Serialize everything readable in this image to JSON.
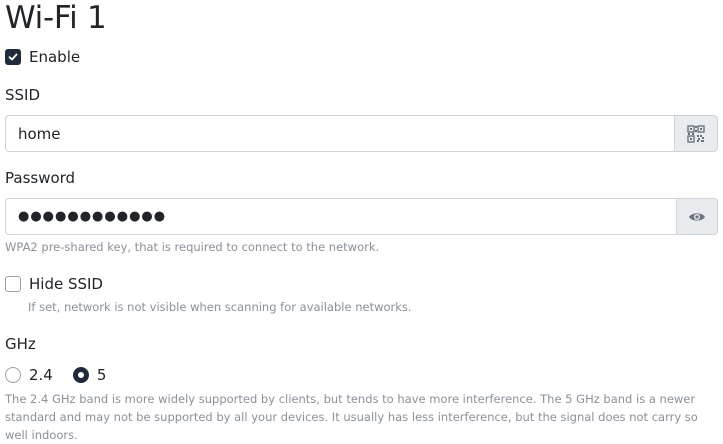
{
  "page": {
    "title": "Wi-Fi 1"
  },
  "enable": {
    "label": "Enable",
    "checked": true
  },
  "ssid": {
    "label": "SSID",
    "value": "home",
    "addon_icon": "qr-code-icon"
  },
  "password": {
    "label": "Password",
    "value_masked": "●●●●●●●●●●●●",
    "addon_icon": "eye-icon",
    "help": "WPA2 pre-shared key, that is required to connect to the network."
  },
  "hide_ssid": {
    "label": "Hide SSID",
    "checked": false,
    "help": "If set, network is not visible when scanning for available networks."
  },
  "ghz": {
    "label": "GHz",
    "options": [
      {
        "label": "2.4",
        "selected": false
      },
      {
        "label": "5",
        "selected": true
      }
    ],
    "help": "The 2.4 GHz band is more widely supported by clients, but tends to have more interference. The 5 GHz band is a newer standard and may not be supported by all your devices. It usually has less interference, but the signal does not carry so well indoors."
  },
  "colors": {
    "text": "#212529",
    "muted": "#8a9199",
    "checked": "#1f2b3a",
    "border": "#ced4da",
    "addon_bg": "#e9ecef"
  }
}
